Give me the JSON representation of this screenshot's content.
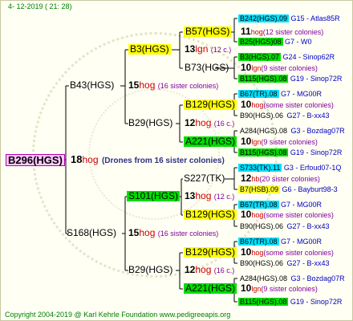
{
  "date": "4- 12-2019 ( 21: 28)",
  "footer": "Copyright 2004-2019 @ Karl Kehrle Foundation   www.pedigreeapis.org",
  "root": {
    "name": "B296(HGS)",
    "count": "18",
    "unit": "hog",
    "note": "(Drones from 16 sister colonies)"
  },
  "g1": {
    "b43": {
      "name": "B43(HGS)",
      "count": "15",
      "unit": "hog",
      "note": "(16 sister colonies)"
    },
    "s168": {
      "name": "S168(HGS)",
      "count": "15",
      "unit": "hog",
      "note": "(16 sister colonies)"
    }
  },
  "g2": {
    "b3": {
      "name": "B3(HGS)",
      "count": "13",
      "unit": "lgn",
      "note": "(12 c.)"
    },
    "b29a": {
      "name": "B29(HGS)",
      "count": "12",
      "unit": "hog",
      "note": "(16 c.)"
    },
    "s101": {
      "name": "S101(HGS)",
      "count": "13",
      "unit": "hog",
      "note": "(12 c.)"
    },
    "b29b": {
      "name": "B29(HGS)",
      "count": "12",
      "unit": "hog",
      "note": "(16 c.)"
    }
  },
  "g3": {
    "b57": {
      "name": "B57(HGS)",
      "count": "11",
      "unit": "hog",
      "note": "(12 sister colonies)"
    },
    "b73": {
      "name": "B73(HGS)",
      "count": "10",
      "unit": "lgn",
      "note": "(9 sister colonies)"
    },
    "b129a": {
      "name": "B129(HGS)",
      "count": "10",
      "unit": "hog",
      "note": "(some sister colonies)"
    },
    "a221a": {
      "name": "A221(HGS)",
      "count": "10",
      "unit": "lgn",
      "note": "(9 sister colonies)"
    },
    "s227": {
      "name": "S227(TK)",
      "count": "12",
      "unit": "hb",
      "note": "(20 sister colonies)"
    },
    "b129b": {
      "name": "B129(HGS)",
      "count": "10",
      "unit": "hog",
      "note": "(some sister colonies)"
    },
    "b129c": {
      "name": "B129(HGS)",
      "count": "10",
      "unit": "hog",
      "note": "(some sister colonies)"
    },
    "a221b": {
      "name": "A221(HGS)",
      "count": "10",
      "unit": "lgn",
      "note": "(9 sister colonies)"
    }
  },
  "g4": [
    {
      "name": "B242(HGS).09",
      "info": "G15 - Atlas85R"
    },
    {
      "name": "B25(HGS)08",
      "info": "G7 - W0"
    },
    {
      "name": "B3(HGS).07",
      "info": "G24 - Sinop62R"
    },
    {
      "name": "B115(HGS).08",
      "info": "G19 - Sinop72R"
    },
    {
      "name": "B67(TR).08",
      "info": "G7 - MG00R"
    },
    {
      "name": "B90(HGS).06",
      "info": "G27 - B-xx43"
    },
    {
      "name": "A284(HGS).08",
      "info": "G3 - Bozdag07R"
    },
    {
      "name": "B115(HGS).08",
      "info": "G19 - Sinop72R"
    },
    {
      "name": "S733(TK).11",
      "info": "G3 - Erfoud07-1Q"
    },
    {
      "name": "B7(HSB).09",
      "info": "G6 - Bayburt98-3"
    },
    {
      "name": "B67(TR).08",
      "info": "G7 - MG00R"
    },
    {
      "name": "B90(HGS).06",
      "info": "G27 - B-xx43"
    },
    {
      "name": "B67(TR).08",
      "info": "G7 - MG00R"
    },
    {
      "name": "B90(HGS).06",
      "info": "G27 - B-xx43"
    },
    {
      "name": "A284(HGS).08",
      "info": "G3 - Bozdag07R"
    },
    {
      "name": "B115(HGS).08",
      "info": "G19 - Sinop72R"
    }
  ]
}
